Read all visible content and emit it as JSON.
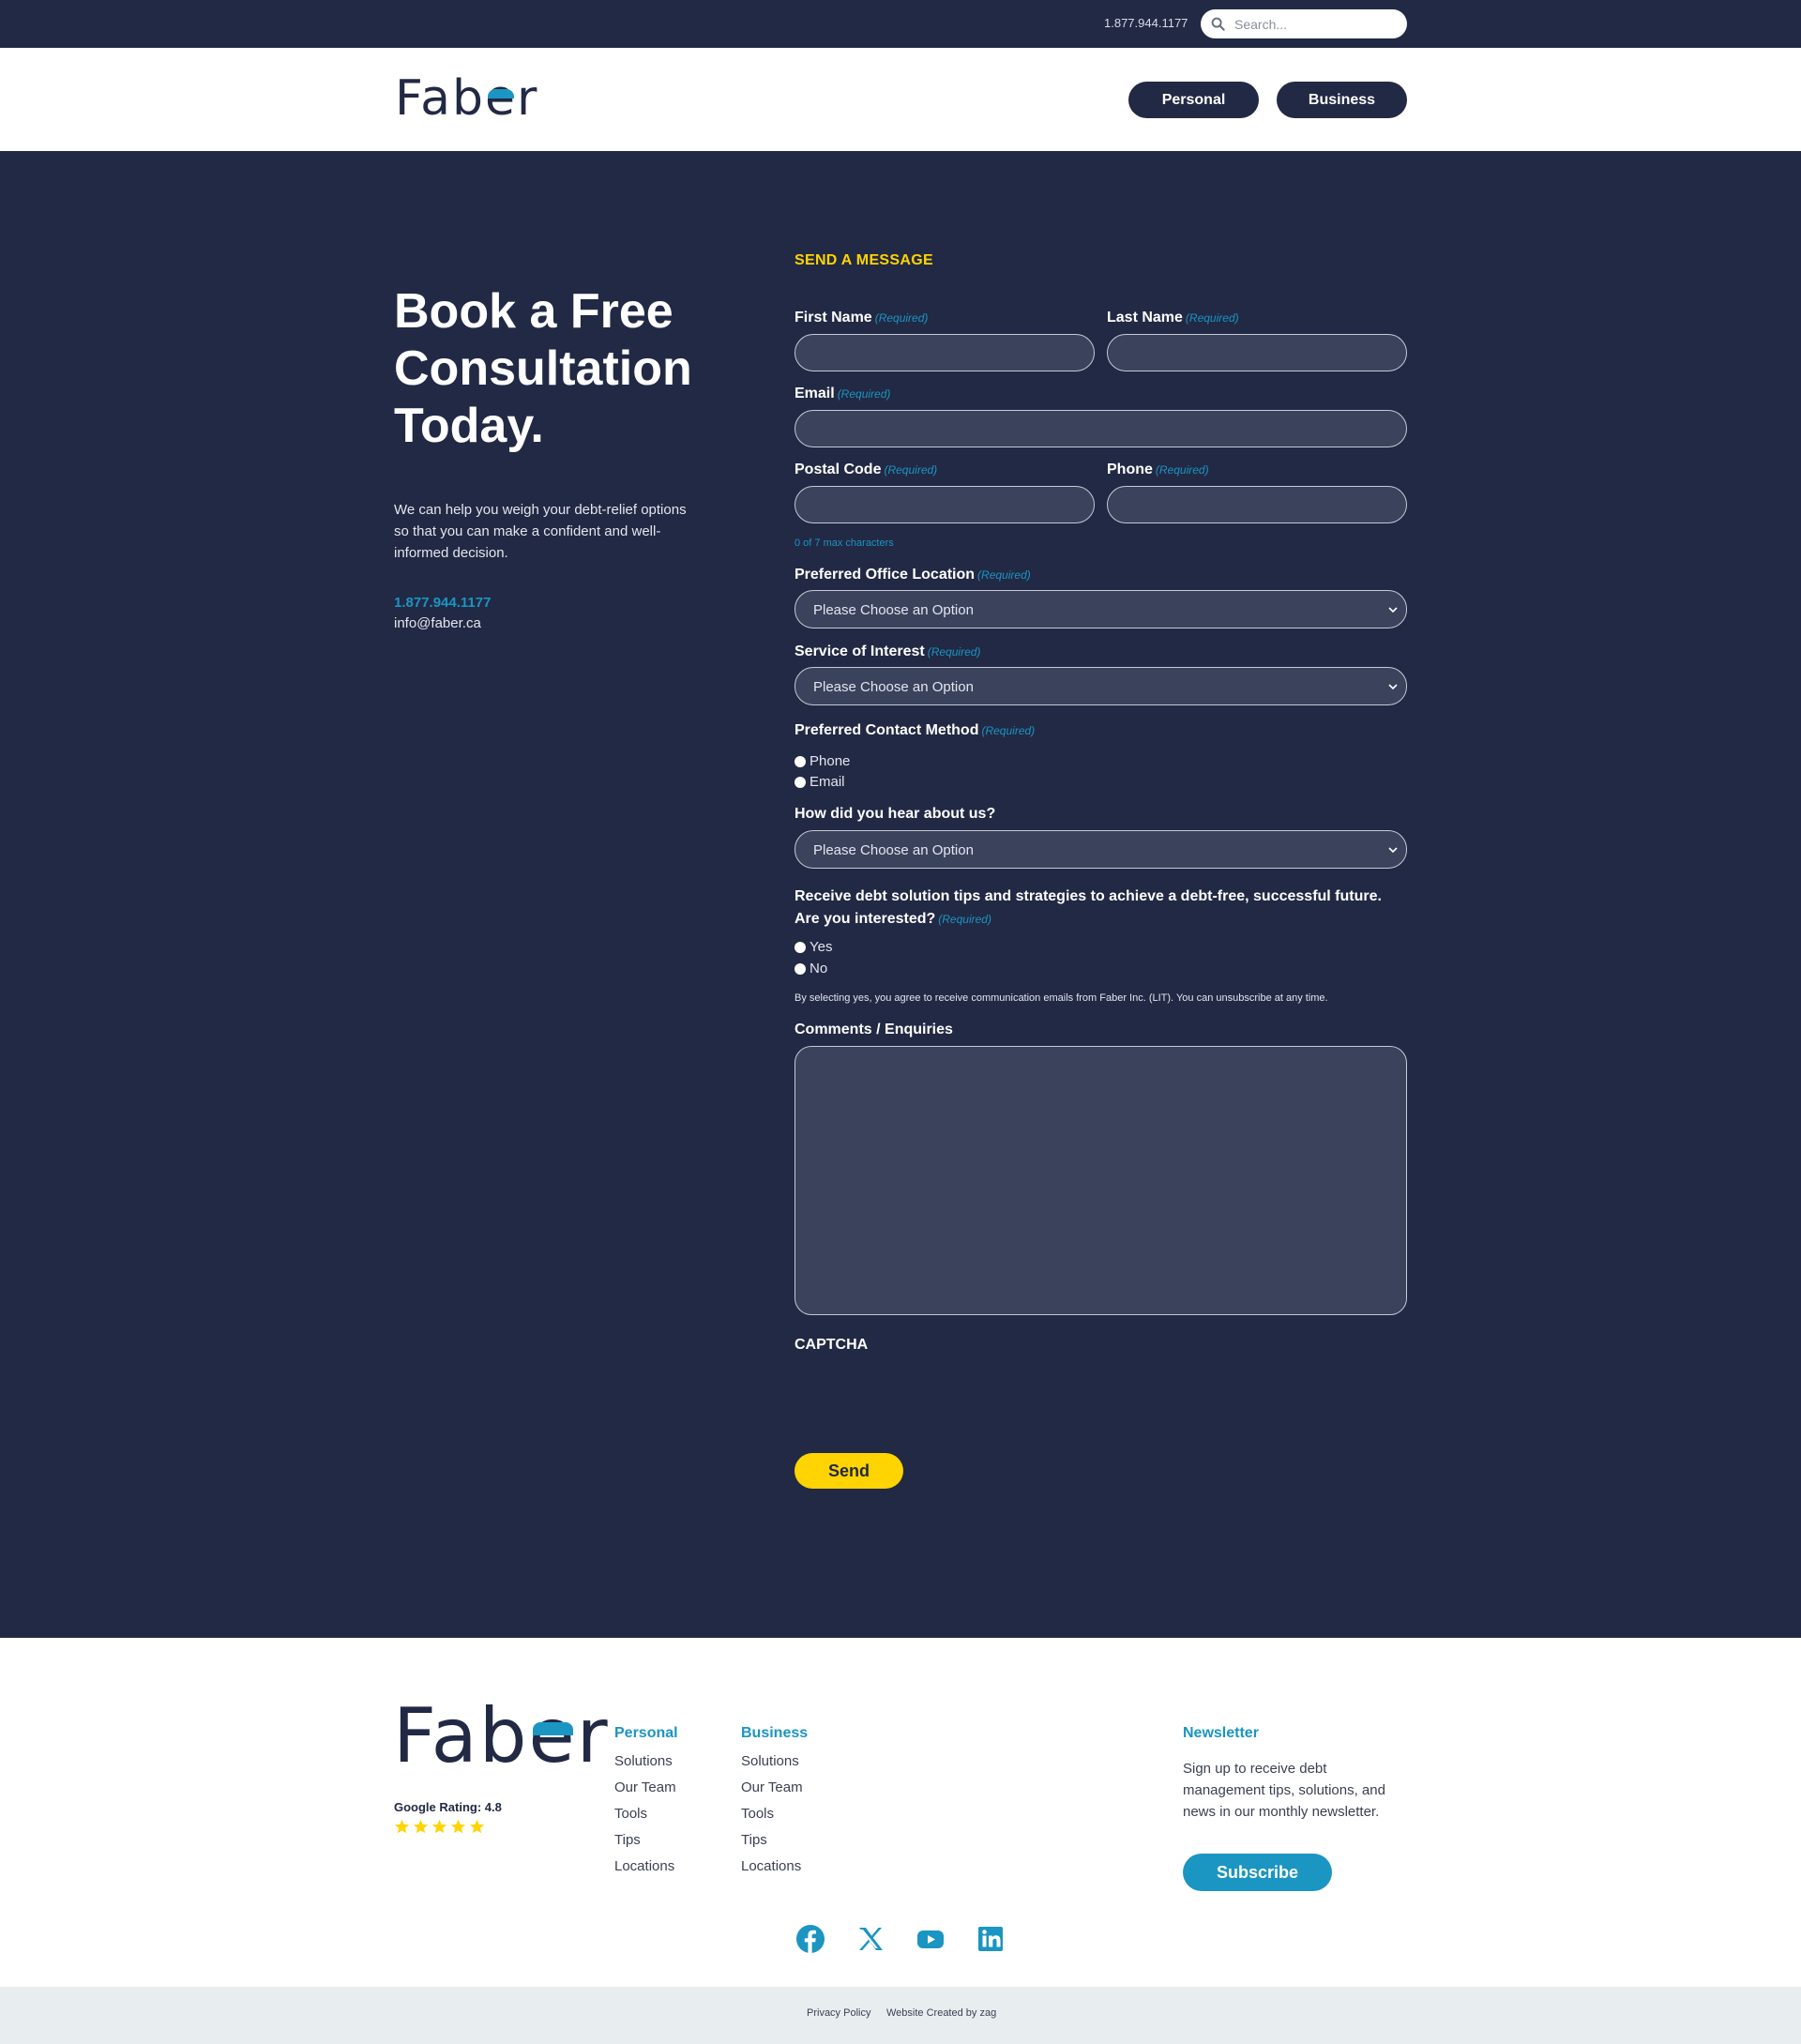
{
  "topbar": {
    "phone": "1.877.944.1177",
    "search_placeholder": "Search..."
  },
  "header": {
    "logo": "Faber",
    "nav": [
      {
        "label": "Personal"
      },
      {
        "label": "Business"
      }
    ]
  },
  "hero": {
    "title": "Book a Free Consultation Today.",
    "text": "We can help you weigh your debt-relief options so that you can make a confident and well-informed decision.",
    "phone": "1.877.944.1177",
    "email": "info@faber.ca"
  },
  "form": {
    "section_title": "SEND A MESSAGE",
    "required_tag": "(Required)",
    "first_name": "First Name",
    "last_name": "Last Name",
    "email": "Email",
    "postal_code": "Postal Code",
    "phone": "Phone",
    "postal_hint": "0 of 7 max characters",
    "office_location": "Preferred Office Location",
    "service": "Service of Interest",
    "select_placeholder": "Please Choose an Option",
    "contact_method": "Preferred Contact Method",
    "contact_options": [
      "Phone",
      "Email"
    ],
    "hear_about": "How did you hear about us?",
    "tips_question": "Receive debt solution tips and strategies to achieve a debt-free, successful future. Are you interested?",
    "tips_options": [
      "Yes",
      "No"
    ],
    "disclaimer": "By selecting yes, you agree to receive communication emails from Faber Inc. (LIT). You can unsubscribe at any time.",
    "comments": "Comments / Enquiries",
    "captcha": "CAPTCHA",
    "send": "Send"
  },
  "footer": {
    "logo": "Faber",
    "rating": "Google Rating: 4.8",
    "stars": 5,
    "personal": {
      "title": "Personal",
      "links": [
        "Solutions",
        "Our Team",
        "Tools",
        "Tips",
        "Locations"
      ]
    },
    "business": {
      "title": "Business",
      "links": [
        "Solutions",
        "Our Team",
        "Tools",
        "Tips",
        "Locations"
      ]
    },
    "newsletter": {
      "title": "Newsletter",
      "text": "Sign up to receive debt management tips, solutions, and news in our monthly newsletter.",
      "button": "Subscribe"
    },
    "social_icons": [
      "facebook-icon",
      "x-icon",
      "youtube-icon",
      "linkedin-icon"
    ],
    "bottom": {
      "privacy": "Privacy Policy",
      "credit": "Website Created by zag"
    }
  },
  "colors": {
    "navy": "#222944",
    "accent_blue": "#1b95c2",
    "accent_yellow": "#ffd400"
  }
}
